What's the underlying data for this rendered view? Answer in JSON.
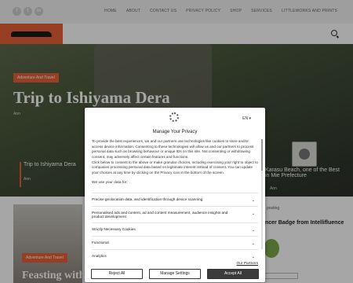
{
  "nav": {
    "social": [
      "f",
      "t",
      "in"
    ],
    "items": [
      "HOME",
      "ABOUT",
      "CONTACT US",
      "PRIVACY POLICY",
      "SHOP",
      "SERVICES",
      "LITTLEWORKS AND PRINTS"
    ]
  },
  "hero": {
    "category": "Adventure And Travel",
    "title": "Trip to Ishiyama Dera",
    "author": "Ann"
  },
  "slides": [
    {
      "title": "Trip to Ishiyama Dera",
      "author": "Ann"
    },
    {
      "title": "Karasu Beach, one of the Best\nin Mie Prefecture",
      "author": "Ann"
    }
  ],
  "card2": {
    "category": "Adventure And Travel",
    "title": "Feasting with"
  },
  "sidebar": {
    "text": "posting",
    "badge_title": "ncer Badge from Intellifluence"
  },
  "consent": {
    "language": "EN",
    "title": "Manage Your Privacy",
    "body": "To provide the best experiences, we and our partners use technologies like cookies to store and/or access device information. Consenting to these technologies will allow us and our partners to process personal data such as browsing behaviour or unique IDs on this site. Not consenting or withdrawing consent, may adversely affect certain features and functions.\nClick below to consent to the above or make granular choices, including exercising your right to object to companies processing personal data based on legitimate interest instead of consent. You can update your choices at any time by clicking on the Privacy icon in the bottom of the screen.",
    "we_use_label": "We use your data for:",
    "purposes": [
      "Precise geolocation data, and identification through device scanning",
      "Personalised ads and content, ad and content measurement, audience insights and product development",
      "Strictly Necessary Cookies",
      "Functional",
      "Analytics"
    ],
    "our_partners": "Our Partners",
    "reject_label": "Reject All",
    "manage_label": "Manage Settings",
    "accept_label": "Accept All"
  }
}
